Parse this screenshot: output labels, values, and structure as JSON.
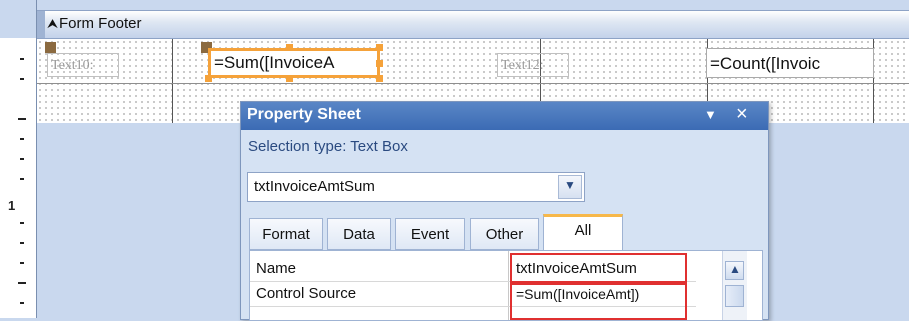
{
  "section": {
    "title": "Form Footer",
    "icon": "up-arrow-icon"
  },
  "ruler": {
    "labels": [
      "1"
    ]
  },
  "controls": {
    "label1": "Text10:",
    "textbox1": "=Sum([InvoiceA",
    "label2": "Text12:",
    "textbox2": "=Count([Invoic"
  },
  "property_sheet": {
    "title": "Property Sheet",
    "selection_type": "Selection type:  Text Box",
    "selected_object": "txtInvoiceAmtSum",
    "tabs": [
      "Format",
      "Data",
      "Event",
      "Other",
      "All"
    ],
    "active_tab": "All",
    "rows": [
      {
        "name": "Name",
        "value": "txtInvoiceAmtSum"
      },
      {
        "name": "Control Source",
        "value": "=Sum([InvoiceAmt])"
      }
    ]
  },
  "colors": {
    "selection": "#f5a23a",
    "highlight": "#e03030",
    "titlebar": "#3b6bb4"
  }
}
